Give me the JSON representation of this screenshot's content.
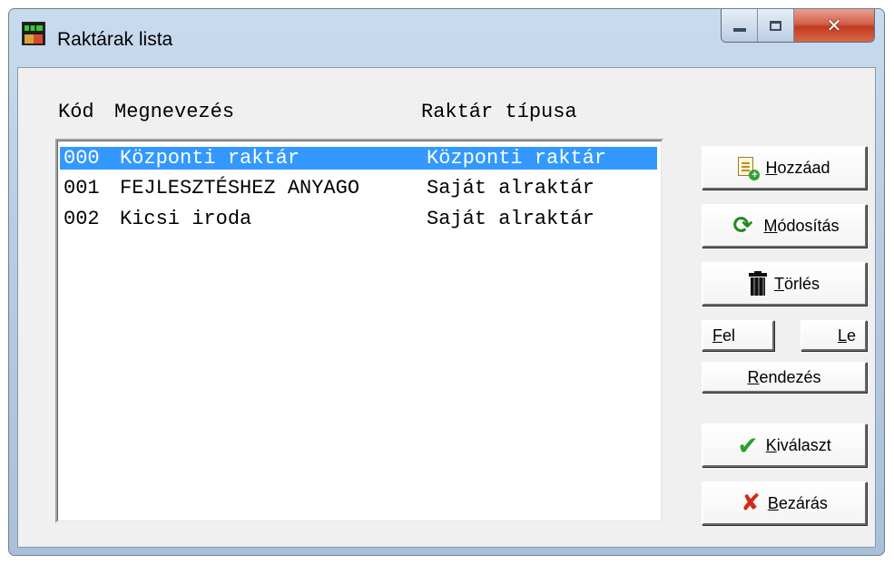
{
  "window": {
    "title": "Raktárak lista",
    "controls": {
      "minimize": "minimize",
      "maximize": "maximize",
      "close": "close"
    }
  },
  "list": {
    "headers": {
      "code": "Kód",
      "name": "Megnevezés",
      "type": "Raktár típusa"
    },
    "rows": [
      {
        "code": "000",
        "name": "Központi raktár",
        "type": "Központi raktár",
        "selected": true
      },
      {
        "code": "001",
        "name": "FEJLESZTÉSHEZ ANYAGO",
        "type": "Saját alraktár",
        "selected": false
      },
      {
        "code": "002",
        "name": "Kicsi iroda",
        "type": "Saját alraktár",
        "selected": false
      }
    ]
  },
  "buttons": {
    "add": {
      "accel": "H",
      "rest": "ozzáad",
      "icon": "add-document-icon"
    },
    "modify": {
      "accel": "M",
      "rest": "ódosítás",
      "icon": "refresh-icon"
    },
    "delete": {
      "accel": "T",
      "rest": "örlés",
      "icon": "trash-icon"
    },
    "up": {
      "accel": "F",
      "rest": "el"
    },
    "down": {
      "accel": "L",
      "rest": "e"
    },
    "sort": {
      "accel": "R",
      "rest": "endezés"
    },
    "select": {
      "accel": "K",
      "rest": "iválaszt",
      "icon": "checkmark-icon"
    },
    "close": {
      "accel": "B",
      "rest": "ezárás",
      "icon": "red-x-icon"
    }
  },
  "colors": {
    "selection": "#3399ff",
    "dialog_bg": "#f0f0f0"
  }
}
